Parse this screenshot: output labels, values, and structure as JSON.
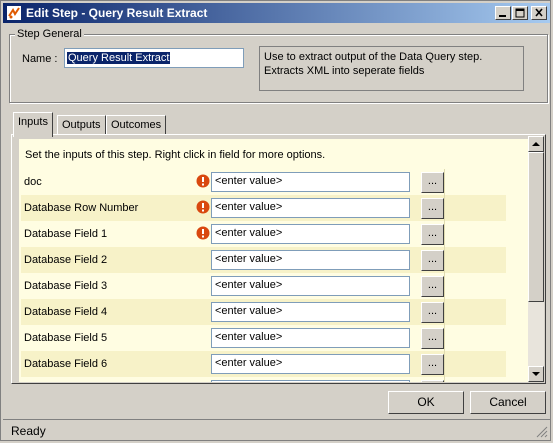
{
  "window": {
    "title": "Edit Step - Query Result Extract"
  },
  "step_general": {
    "legend": "Step General",
    "name_label": "Name :",
    "name_value": "Query Result Extract",
    "description": "Use to extract output of the Data Query step. Extracts XML into seperate fields"
  },
  "tabs": [
    {
      "label": "Inputs",
      "active": true
    },
    {
      "label": "Outputs",
      "active": false
    },
    {
      "label": "Outcomes",
      "active": false
    }
  ],
  "inputs": {
    "instructions": "Set the inputs of this step.  Right click in field for more options.",
    "rows": [
      {
        "label": "doc",
        "value": "<enter value>",
        "required": true
      },
      {
        "label": "Database Row Number",
        "value": "<enter value>",
        "required": true
      },
      {
        "label": "Database Field 1",
        "value": "<enter value>",
        "required": true
      },
      {
        "label": "Database Field 2",
        "value": "<enter value>",
        "required": false
      },
      {
        "label": "Database Field 3",
        "value": "<enter value>",
        "required": false
      },
      {
        "label": "Database Field 4",
        "value": "<enter value>",
        "required": false
      },
      {
        "label": "Database Field 5",
        "value": "<enter value>",
        "required": false
      },
      {
        "label": "Database Field 6",
        "value": "<enter value>",
        "required": false
      },
      {
        "label": "",
        "value": "",
        "required": false
      }
    ],
    "ellipsis_label": "..."
  },
  "buttons": {
    "ok": "OK",
    "cancel": "Cancel"
  },
  "status": {
    "text": "Ready"
  },
  "icons": {
    "app": "app-icon",
    "minimize": "minimize-icon",
    "maximize": "maximize-icon",
    "close": "close-icon",
    "warning": "warning-icon",
    "scroll_up": "arrow-up-icon",
    "scroll_down": "arrow-down-icon"
  },
  "colors": {
    "titlebar_start": "#0a246a",
    "titlebar_end": "#a6caf0",
    "grid_odd": "#fffde2",
    "grid_even": "#f7f2c8",
    "warning": "#d9480f"
  }
}
